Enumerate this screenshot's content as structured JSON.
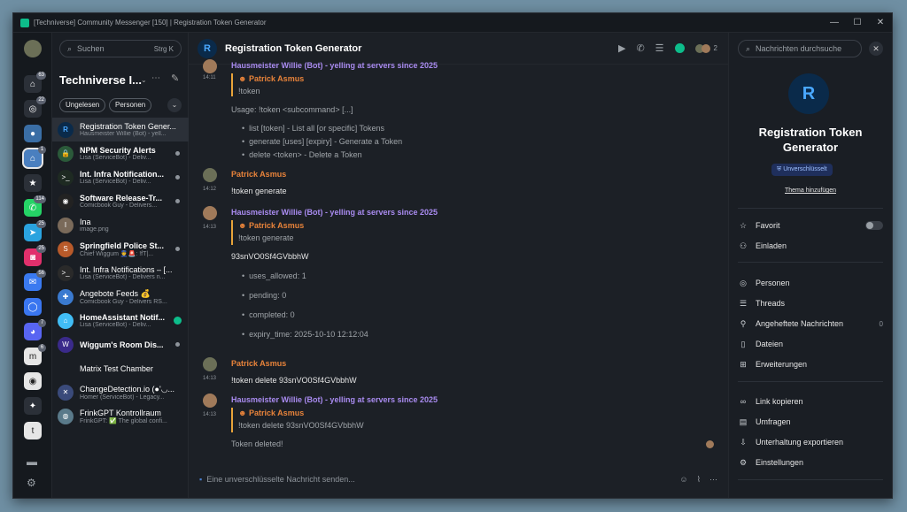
{
  "window": {
    "title": "[Techniverse] Community Messenger [150] | Registration Token Generator"
  },
  "rail": {
    "spaces": [
      {
        "name": "home-space-icon",
        "badge": "63",
        "color": "#2b3038",
        "glyph": "⌂"
      },
      {
        "name": "settings-space-icon",
        "badge": "22",
        "color": "#2b3038",
        "glyph": "◎"
      },
      {
        "name": "space-1-icon",
        "badge": "",
        "color": "#3a6ea5",
        "glyph": "●"
      },
      {
        "name": "techniverse-space-icon",
        "badge": "1",
        "color": "#4a7fbf",
        "glyph": "⌂"
      },
      {
        "name": "favourites-space-icon",
        "badge": "",
        "color": "#2b3038",
        "glyph": "★"
      },
      {
        "name": "whatsapp-space-icon",
        "badge": "114",
        "color": "#25d366",
        "glyph": "✆"
      },
      {
        "name": "telegram-space-icon",
        "badge": "25",
        "color": "#2aa3df",
        "glyph": "➤"
      },
      {
        "name": "instagram-space-icon",
        "badge": "25",
        "color": "#e1306c",
        "glyph": "◙"
      },
      {
        "name": "messenger-space-icon",
        "badge": "56",
        "color": "#3a7af0",
        "glyph": "✉"
      },
      {
        "name": "signal-space-icon",
        "badge": "",
        "color": "#3a76f0",
        "glyph": "◯"
      },
      {
        "name": "discord-space-icon",
        "badge": "7",
        "color": "#5865f2",
        "glyph": "◕"
      },
      {
        "name": "matrix-space-icon",
        "badge": "6",
        "color": "#e6e6e6",
        "glyph": "m"
      },
      {
        "name": "webhook-space-icon",
        "badge": "",
        "color": "#e6e6e6",
        "glyph": "◉"
      },
      {
        "name": "bot-space-icon",
        "badge": "",
        "color": "#2b3038",
        "glyph": "✦"
      },
      {
        "name": "tumblr-space-icon",
        "badge": "",
        "color": "#e6e6e6",
        "glyph": "t"
      }
    ],
    "bottom": [
      "chat-icon",
      "settings-icon"
    ]
  },
  "roomlist": {
    "search_placeholder": "Suchen",
    "search_shortcut": "Strg K",
    "space_title": "Techniverse I...",
    "filters": [
      "Ungelesen",
      "Personen"
    ],
    "rooms": [
      {
        "name": "Registration Token Gener...",
        "preview": "Hausmeister Willie (Bot) - yell...",
        "avatar": "R",
        "color": "#0a2a4a",
        "bold": false,
        "selected": true,
        "unread": false
      },
      {
        "name": "NPM Security Alerts",
        "preview": "Lisa (ServiceBot) - Deliv...",
        "avatar": "🔒",
        "color": "#2b5a3a",
        "bold": true,
        "selected": false,
        "unread": true
      },
      {
        "name": "Int. Infra Notification...",
        "preview": "Lisa (ServiceBot) - Deliv...",
        "avatar": ">_",
        "color": "#1e2a22",
        "bold": true,
        "selected": false,
        "unread": true
      },
      {
        "name": "Software Release-Tr...",
        "preview": "Comicbook Guy - Delivers...",
        "avatar": "◉",
        "color": "#222",
        "bold": true,
        "selected": false,
        "unread": true
      },
      {
        "name": "Ina",
        "preview": "image.png",
        "avatar": "I",
        "color": "#7a6a5a",
        "bold": false,
        "selected": false,
        "unread": false
      },
      {
        "name": "Springfield Police St...",
        "preview": "Chief Wiggum 👮🚨: !fT|...",
        "avatar": "S",
        "color": "#b85a2a",
        "bold": true,
        "selected": false,
        "unread": true
      },
      {
        "name": "Int. Infra Notifications – [...",
        "preview": "Lisa (ServiceBot) - Delivers n...",
        "avatar": ">_",
        "color": "#2a2a2a",
        "bold": false,
        "selected": false,
        "unread": false
      },
      {
        "name": "Angebote Feeds 💰",
        "preview": "Comicbook Guy - Delivers RS...",
        "avatar": "✚",
        "color": "#3a7ad0",
        "bold": false,
        "selected": false,
        "unread": false
      },
      {
        "name": "HomeAssistant Notif...",
        "preview": "Lisa (ServiceBot) - Deliv...",
        "avatar": "⌂",
        "color": "#41bdf5",
        "bold": true,
        "selected": false,
        "unread": true
      },
      {
        "name": "Wiggum's Room Dis...",
        "preview": "",
        "avatar": "W",
        "color": "#3a2a8a",
        "bold": true,
        "selected": false,
        "unread": true
      },
      {
        "name": "Matrix Test Chamber",
        "preview": "",
        "avatar": "",
        "color": "#1a1e24",
        "bold": false,
        "selected": false,
        "unread": false
      },
      {
        "name": "ChangeDetection.io (●'◡...",
        "preview": "Homer (ServiceBot) - Legacy...",
        "avatar": "✕",
        "color": "#3a4a7a",
        "bold": false,
        "selected": false,
        "unread": false
      },
      {
        "name": "FrinkGPT Kontrollraum",
        "preview": "FrinkGPT: ✅ The global confi...",
        "avatar": "◍",
        "color": "#5a7a8a",
        "bold": false,
        "selected": false,
        "unread": false
      }
    ]
  },
  "header": {
    "room_name": "Registration Token Generator",
    "avatar_letter": "R",
    "member_count": "2"
  },
  "timeline": {
    "m0": {
      "sender": "Hausmeister Willie (Bot) - yelling at servers since 2025",
      "time": "14:11",
      "reply_to": "Patrick Asmus",
      "reply_text": "!token",
      "usage": "Usage: !token <subcommand> [...]",
      "items": [
        "list [token] - List all [or specific] Tokens",
        "generate [uses] [expiry] - Generate a Token",
        "delete <token> - Delete a Token"
      ]
    },
    "m1": {
      "sender": "Patrick Asmus",
      "time": "14:12",
      "text": "!token generate"
    },
    "m2": {
      "sender": "Hausmeister Willie (Bot) - yelling at servers since 2025",
      "time": "14:13",
      "reply_to": "Patrick Asmus",
      "reply_text": "!token generate",
      "token": "93snVO0Sf4GVbbhW",
      "items": [
        "uses_allowed: 1",
        "pending: 0",
        "completed: 0",
        "expiry_time: 2025-10-10 12:12:04"
      ]
    },
    "m3": {
      "sender": "Patrick Asmus",
      "time": "14:13",
      "text": "!token delete 93snVO0Sf4GVbbhW"
    },
    "m4": {
      "sender": "Hausmeister Willie (Bot) - yelling at servers since 2025",
      "time": "14:13",
      "reply_to": "Patrick Asmus",
      "reply_text": "!token delete 93snVO0Sf4GVbbhW",
      "text": "Token deleted!"
    }
  },
  "composer": {
    "placeholder": "Eine unverschlüsselte Nachricht senden..."
  },
  "panel": {
    "search_placeholder": "Nachrichten durchsuche",
    "avatar_letter": "R",
    "room_name": "Registration Token Generator",
    "encryption": "Unverschlüsselt",
    "add_topic": "Thema hinzufügen",
    "favourite": "Favorit",
    "invite": "Einladen",
    "people": "Personen",
    "threads": "Threads",
    "pinned": "Angeheftete Nachrichten",
    "pinned_count": "0",
    "files": "Dateien",
    "extensions": "Erweiterungen",
    "copy_link": "Link kopieren",
    "polls": "Umfragen",
    "export": "Unterhaltung exportieren",
    "settings": "Einstellungen"
  }
}
